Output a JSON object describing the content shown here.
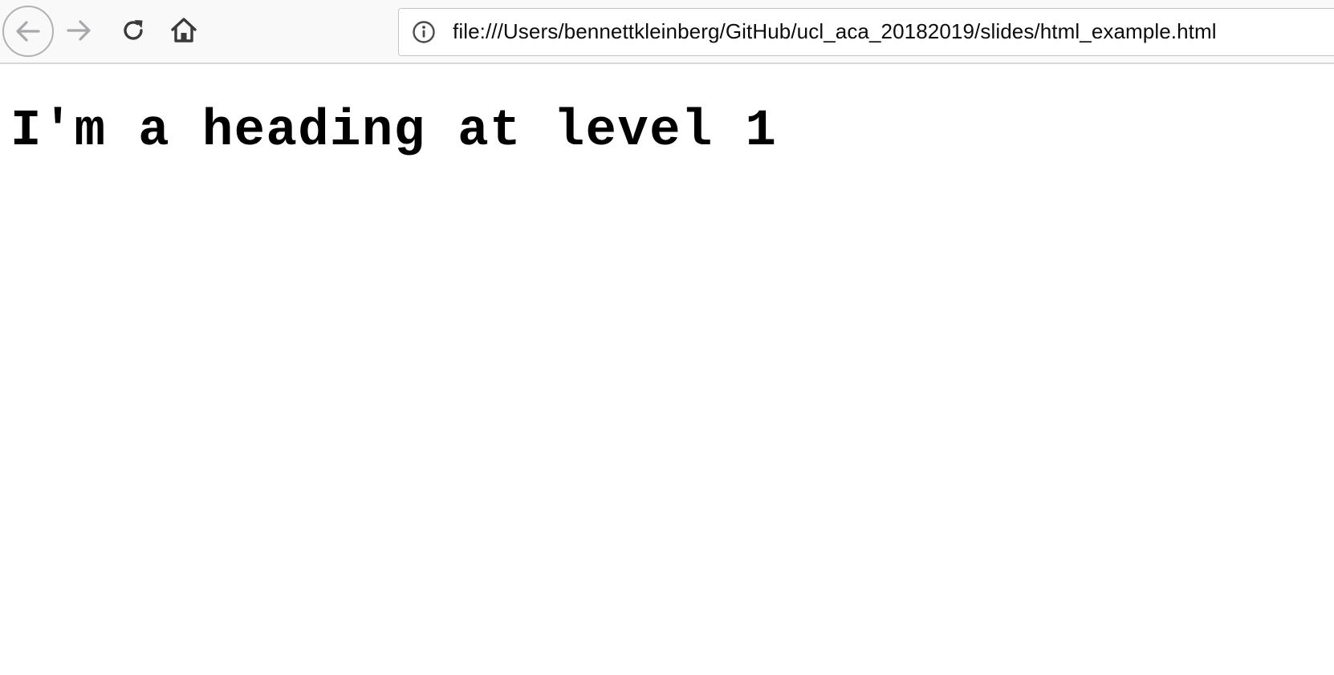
{
  "browser": {
    "toolbar": {
      "back_icon": "arrow-left-icon",
      "forward_icon": "arrow-right-icon",
      "reload_icon": "reload-icon",
      "home_icon": "home-icon"
    },
    "urlbar": {
      "info_icon": "info-icon",
      "url": "file:///Users/bennettkleinberg/GitHub/ucl_aca_20182019/slides/html_example.html"
    }
  },
  "page": {
    "heading": "I'm a heading at level 1"
  },
  "colors": {
    "toolbar_bg": "#f9f9fa",
    "icon_active": "#3a3a3d",
    "icon_disabled": "#a9a9ad",
    "text": "#000000"
  }
}
